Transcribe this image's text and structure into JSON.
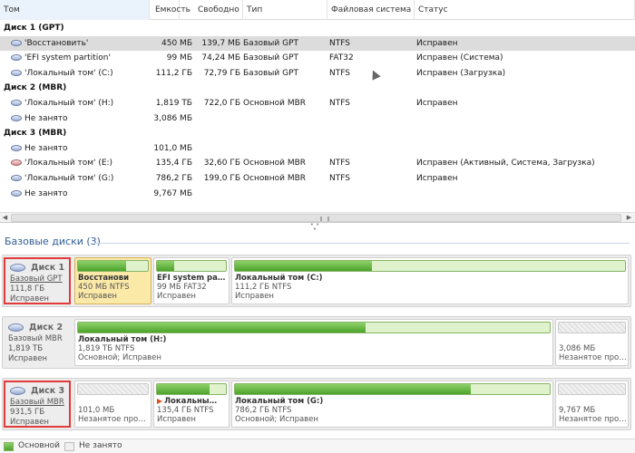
{
  "columns": [
    "Том",
    "Емкость",
    "Свободно",
    "Тип",
    "Файловая система",
    "Статус"
  ],
  "rows": [
    {
      "group": "Диск 1 (GPT)"
    },
    {
      "name": "'Восстановить'",
      "capacity": "450 МБ",
      "free": "139,7 МБ",
      "type": "Базовый GPT",
      "fs": "NTFS",
      "status": "Исправен",
      "selected": true,
      "icon": "volume-icon"
    },
    {
      "name": "'EFI system partition'",
      "capacity": "99 МБ",
      "free": "74,24 МБ",
      "type": "Базовый GPT",
      "fs": "FAT32",
      "status": "Исправен (Система)",
      "icon": "volume-icon"
    },
    {
      "name": "'Локальный том' (C:)",
      "capacity": "111,2 ГБ",
      "free": "72,79 ГБ",
      "type": "Базовый GPT",
      "fs": "NTFS",
      "status": "Исправен (Загрузка)",
      "icon": "volume-icon"
    },
    {
      "group": "Диск 2 (MBR)"
    },
    {
      "name": "'Локальный том' (H:)",
      "capacity": "1,819 ТБ",
      "free": "722,0 ГБ",
      "type": "Основной MBR",
      "fs": "NTFS",
      "status": "Исправен",
      "icon": "volume-icon"
    },
    {
      "name": "Не занято",
      "capacity": "3,086 МБ",
      "free": "",
      "type": "",
      "fs": "",
      "status": "",
      "icon": "volume-icon"
    },
    {
      "group": "Диск 3 (MBR)"
    },
    {
      "name": "Не занято",
      "capacity": "101,0 МБ",
      "free": "",
      "type": "",
      "fs": "",
      "status": "",
      "icon": "volume-icon"
    },
    {
      "name": "'Локальный том' (E:)",
      "capacity": "135,4 ГБ",
      "free": "32,60 ГБ",
      "type": "Основной MBR",
      "fs": "NTFS",
      "status": "Исправен (Активный, Система, Загрузка)",
      "icon": "flag-volume-icon"
    },
    {
      "name": "'Локальный том' (G:)",
      "capacity": "786,2 ГБ",
      "free": "199,0 ГБ",
      "type": "Основной MBR",
      "fs": "NTFS",
      "status": "Исправен",
      "icon": "volume-icon"
    },
    {
      "name": "Не занято",
      "capacity": "9,767 МБ",
      "free": "",
      "type": "",
      "fs": "",
      "status": "",
      "icon": "volume-icon"
    }
  ],
  "section_title": "Базовые диски (3)",
  "disks": [
    {
      "name": "Диск 1",
      "type": "Базовый GPT",
      "size": "111,8 ГБ",
      "status": "Исправен",
      "partitions": [
        {
          "name": "Восстанови",
          "line2": "450 МБ NTFS",
          "line3": "Исправен",
          "used_fraction": 0.69,
          "kind": "primary",
          "selected": true
        },
        {
          "name": "EFI system pa…",
          "line2": "99 МБ FAT32",
          "line3": "Исправен",
          "used_fraction": 0.25,
          "kind": "primary"
        },
        {
          "name": "Локальный том (C:)",
          "line2": "111,2 ГБ NTFS",
          "line3": "Исправен",
          "used_fraction": 0.35,
          "kind": "primary"
        }
      ]
    },
    {
      "name": "Диск 2",
      "type": "Базовый MBR",
      "size": "1,819 ТБ",
      "status": "Исправен",
      "partitions": [
        {
          "name": "Локальный том (H:)",
          "line2": "1,819 ТБ NTFS",
          "line3": "Основной; Исправен",
          "used_fraction": 0.61,
          "kind": "primary"
        },
        {
          "name": "",
          "line2": "3,086 МБ",
          "line3": "Незанятое про…",
          "used_fraction": 0,
          "kind": "free"
        }
      ]
    },
    {
      "name": "Диск 3",
      "type": "Базовый MBR",
      "size": "931,5 ГБ",
      "status": "Исправен",
      "partitions": [
        {
          "name": "",
          "line2": "101,0 МБ",
          "line3": "Незанятое про…",
          "used_fraction": 0,
          "kind": "free"
        },
        {
          "name": "Локальны…",
          "line2": "135,4 ГБ NTFS",
          "line3": "Исправен",
          "used_fraction": 0.76,
          "kind": "primary",
          "flag": true
        },
        {
          "name": "Локальный том (G:)",
          "line2": "786,2 ГБ NTFS",
          "line3": "Основной; Исправен",
          "used_fraction": 0.75,
          "kind": "primary"
        },
        {
          "name": "",
          "line2": "9,767 МБ",
          "line3": "Незанятое про…",
          "used_fraction": 0,
          "kind": "free"
        }
      ]
    }
  ],
  "legend": {
    "primary": "Основной",
    "free": "Не занято"
  },
  "colors": {
    "primary_fill": "#4da32c",
    "selection_highlight": "#fbe9a8",
    "annotation_box": "#e23a3a",
    "section_title": "#2e5d99"
  }
}
